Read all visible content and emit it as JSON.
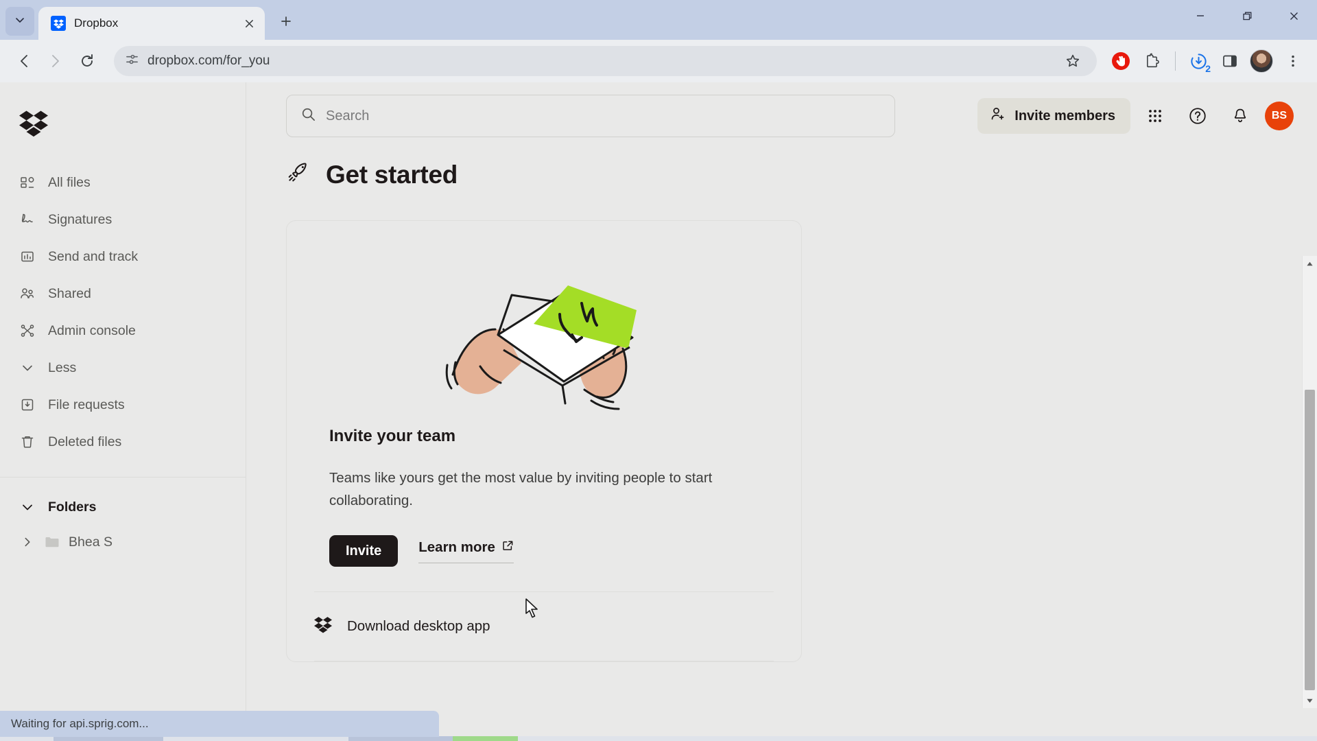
{
  "browser": {
    "tab": {
      "title": "Dropbox",
      "favicon": "dropbox-icon"
    },
    "tab_list_icon": "chevron-down-icon",
    "new_tab_icon": "plus-icon",
    "window_controls": {
      "minimize": "minimize-icon",
      "maximize": "restore-icon",
      "close": "close-icon"
    },
    "nav": {
      "back": "back-arrow-icon",
      "forward": "forward-arrow-icon",
      "reload": "reload-icon"
    },
    "omnibox": {
      "url": "dropbox.com/for_you",
      "site_info_icon": "site-settings-icon",
      "bookmark_icon": "star-icon"
    },
    "toolbar_icons": [
      {
        "name": "adblock-icon",
        "color": "#e8180c"
      },
      {
        "name": "extensions-puzzle-icon"
      },
      {
        "name": "downloads-icon",
        "badge": "2",
        "badge_color": "#1a73e8"
      },
      {
        "name": "side-panel-icon"
      },
      {
        "name": "profile-avatar-icon"
      },
      {
        "name": "chrome-menu-icon"
      }
    ],
    "status_text": "Waiting for api.sprig.com..."
  },
  "sidebar": {
    "logo": "dropbox-logo",
    "items": [
      {
        "label": "All files",
        "icon": "all-files-icon"
      },
      {
        "label": "Signatures",
        "icon": "signature-icon"
      },
      {
        "label": "Send and track",
        "icon": "send-and-track-icon"
      },
      {
        "label": "Shared",
        "icon": "shared-people-icon"
      },
      {
        "label": "Admin console",
        "icon": "admin-console-icon"
      },
      {
        "label": "Less",
        "icon": "chevron-down-icon"
      },
      {
        "label": "File requests",
        "icon": "file-request-icon"
      },
      {
        "label": "Deleted files",
        "icon": "trash-icon"
      }
    ],
    "folders_header": {
      "label": "Folders",
      "icon": "chevron-down-icon"
    },
    "folders": [
      {
        "label": "Bhea S",
        "icon": "folder-icon",
        "expander": "chevron-right-icon"
      }
    ]
  },
  "header": {
    "search": {
      "placeholder": "Search",
      "icon": "search-icon",
      "value": ""
    },
    "invite_members": {
      "label": "Invite members",
      "icon": "person-plus-icon"
    },
    "apps_icon": "apps-grid-icon",
    "help_icon": "help-circle-icon",
    "notifications_icon": "bell-icon",
    "avatar": {
      "initials": "BS",
      "color": "#e8420a"
    }
  },
  "main": {
    "title": "Get started",
    "title_icon": "rocket-icon",
    "card": {
      "illustration": "hands-holding-envelope-illustration",
      "illustration_accent": "#a4dd26",
      "title": "Invite your team",
      "description": "Teams like yours get the most value by inviting people to start collaborating.",
      "primary_button": "Invite",
      "secondary_link": "Learn more",
      "secondary_link_icon": "external-link-icon",
      "row_item": {
        "label": "Download desktop app",
        "icon": "dropbox-icon"
      }
    }
  },
  "scrollbar": {
    "up_icon": "scroll-up-arrow",
    "down_icon": "scroll-down-arrow"
  }
}
